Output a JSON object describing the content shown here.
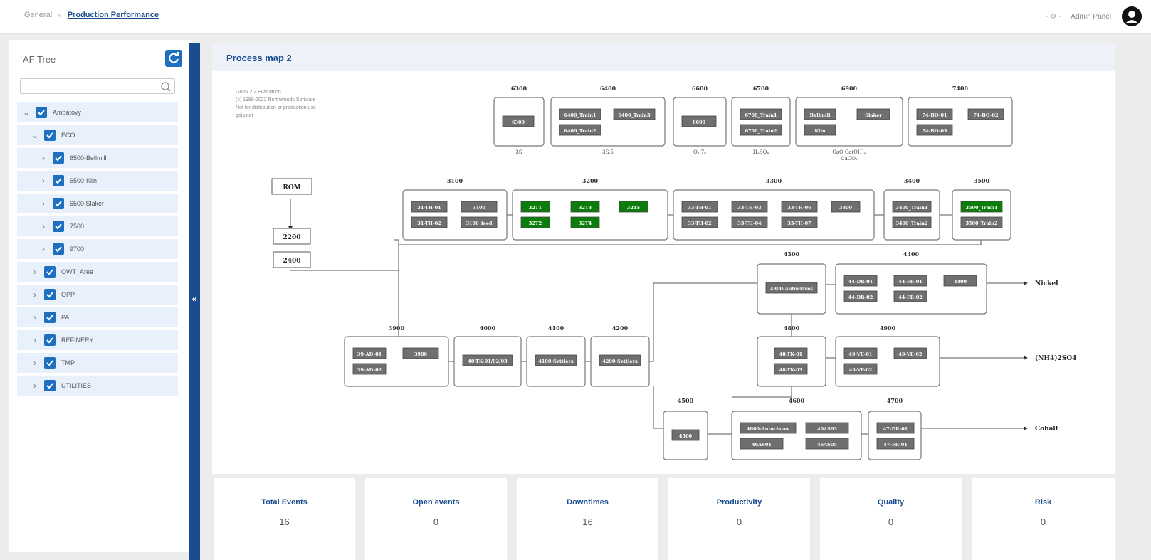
{
  "header": {
    "breadcrumb_home": "General",
    "breadcrumb_sep": "»",
    "breadcrumb_current": "Production Performance",
    "meta": "· ⚙ ·",
    "user": "Admin Panel"
  },
  "tree": {
    "title": "AF Tree",
    "search_placeholder": "",
    "items": [
      {
        "label": "Ambatovy",
        "level": 0,
        "expanded": true
      },
      {
        "label": "ECO",
        "level": 1,
        "expanded": true
      },
      {
        "label": "6500-Bellmill",
        "level": 2,
        "expanded": false
      },
      {
        "label": "6500-Kiln",
        "level": 2,
        "expanded": false
      },
      {
        "label": "6500 Slaker",
        "level": 2,
        "expanded": false
      },
      {
        "label": "7500",
        "level": 2,
        "expanded": false
      },
      {
        "label": "9700",
        "level": 2,
        "expanded": false
      },
      {
        "label": "OWT_Area",
        "level": 1,
        "expanded": false
      },
      {
        "label": "OPP",
        "level": 1,
        "expanded": false
      },
      {
        "label": "PAL",
        "level": 1,
        "expanded": false
      },
      {
        "label": "REFINERY",
        "level": 1,
        "expanded": false
      },
      {
        "label": "TMP",
        "level": 1,
        "expanded": false
      },
      {
        "label": "UTILITIES",
        "level": 1,
        "expanded": false
      }
    ]
  },
  "panel": {
    "title": "Process map 2",
    "watermark": [
      "GoJS 2.2 Evaluation",
      "(c) 1998-2022 Northwoods Software",
      "Not for distribution or production use",
      "gojs.net"
    ]
  },
  "colors": {
    "node_gray": "#6f6f6f",
    "node_green": "#0b7d0b",
    "accent": "#1a4d8f"
  },
  "map": {
    "groups": [
      {
        "id": "6300",
        "label": "6300",
        "sub": "3S",
        "nodes": [
          {
            "t": "6300",
            "s": "gray"
          }
        ]
      },
      {
        "id": "6400",
        "label": "6400",
        "sub": "3S.5",
        "nodes": [
          {
            "t": "6400_Train1",
            "s": "gray"
          },
          {
            "t": "6400_Train3",
            "s": "gray"
          },
          {
            "t": "6400_Train2",
            "s": "gray"
          }
        ]
      },
      {
        "id": "6600",
        "label": "6600",
        "sub": "O₂ 7₅",
        "nodes": [
          {
            "t": "6600",
            "s": "gray"
          }
        ]
      },
      {
        "id": "6700",
        "label": "6700",
        "sub": "H₂SO₄",
        "nodes": [
          {
            "t": "6700_Train1",
            "s": "gray"
          },
          {
            "t": "6700_Train2",
            "s": "gray"
          }
        ]
      },
      {
        "id": "6900",
        "label": "6900",
        "sub": "CaO Ca(OH)₂",
        "sub2": "CaCO₃",
        "nodes": [
          {
            "t": "Ballmill",
            "s": "gray"
          },
          {
            "t": "Slaker",
            "s": "gray"
          },
          {
            "t": "Kiln",
            "s": "gray"
          }
        ]
      },
      {
        "id": "7400",
        "label": "7400",
        "sub": "",
        "nodes": [
          {
            "t": "74-BO-01",
            "s": "gray"
          },
          {
            "t": "74-BO-02",
            "s": "gray"
          },
          {
            "t": "74-BO-03",
            "s": "gray"
          }
        ]
      },
      {
        "id": "3100",
        "label": "3100",
        "sub": "",
        "nodes": [
          {
            "t": "31-TH-01",
            "s": "gray"
          },
          {
            "t": "3100",
            "s": "gray"
          },
          {
            "t": "31-TH-02",
            "s": "gray"
          },
          {
            "t": "3100_feed",
            "s": "gray"
          }
        ]
      },
      {
        "id": "3200",
        "label": "3200",
        "sub": "",
        "nodes": [
          {
            "t": "32T1",
            "s": "green"
          },
          {
            "t": "32T3",
            "s": "green"
          },
          {
            "t": "32T5",
            "s": "green"
          },
          {
            "t": "32T2",
            "s": "green"
          },
          {
            "t": "32T4",
            "s": "green"
          }
        ]
      },
      {
        "id": "3300",
        "label": "3300",
        "sub": "",
        "nodes": [
          {
            "t": "33-TH-01",
            "s": "gray"
          },
          {
            "t": "33-TH-03",
            "s": "gray"
          },
          {
            "t": "33-TH-06",
            "s": "gray"
          },
          {
            "t": "3300",
            "s": "gray"
          },
          {
            "t": "33-TH-02",
            "s": "gray"
          },
          {
            "t": "33-TH-04",
            "s": "gray"
          },
          {
            "t": "33-TH-07",
            "s": "gray"
          }
        ]
      },
      {
        "id": "3400",
        "label": "3400",
        "sub": "",
        "nodes": [
          {
            "t": "3400_Train1",
            "s": "gray"
          },
          {
            "t": "3400_Train2",
            "s": "gray"
          }
        ]
      },
      {
        "id": "3500",
        "label": "3500",
        "sub": "",
        "nodes": [
          {
            "t": "3500_Train1",
            "s": "green"
          },
          {
            "t": "3500_Train2",
            "s": "gray"
          }
        ]
      },
      {
        "id": "4300",
        "label": "4300",
        "sub": "",
        "nodes": [
          {
            "t": "4300-Autoclaves",
            "s": "gray"
          }
        ]
      },
      {
        "id": "4400",
        "label": "4400",
        "sub": "",
        "nodes": [
          {
            "t": "44-DR-01",
            "s": "gray"
          },
          {
            "t": "44-FR-01",
            "s": "gray"
          },
          {
            "t": "4400",
            "s": "gray"
          },
          {
            "t": "44-DR-02",
            "s": "gray"
          },
          {
            "t": "44-FR-02",
            "s": "gray"
          }
        ]
      },
      {
        "id": "3900",
        "label": "3900",
        "sub": "",
        "nodes": [
          {
            "t": "39-AD-01",
            "s": "gray"
          },
          {
            "t": "3900",
            "s": "gray"
          },
          {
            "t": "39-AD-02",
            "s": "gray"
          }
        ]
      },
      {
        "id": "4000",
        "label": "4000",
        "sub": "",
        "nodes": [
          {
            "t": "40-TK-01/02/03",
            "s": "gray"
          }
        ]
      },
      {
        "id": "4100",
        "label": "4100",
        "sub": "",
        "nodes": [
          {
            "t": "4100-Settlers",
            "s": "gray"
          }
        ]
      },
      {
        "id": "4200",
        "label": "4200",
        "sub": "",
        "nodes": [
          {
            "t": "4200-Settlers",
            "s": "gray"
          }
        ]
      },
      {
        "id": "4800",
        "label": "4800",
        "sub": "",
        "nodes": [
          {
            "t": "48-TK-01",
            "s": "gray"
          },
          {
            "t": "48-TK-03",
            "s": "gray"
          }
        ]
      },
      {
        "id": "4900",
        "label": "4900",
        "sub": "",
        "nodes": [
          {
            "t": "49-VE-01",
            "s": "gray"
          },
          {
            "t": "49-VE-02",
            "s": "gray"
          },
          {
            "t": "49-VP-02",
            "s": "gray"
          }
        ]
      },
      {
        "id": "4500",
        "label": "4500",
        "sub": "",
        "nodes": [
          {
            "t": "4500",
            "s": "gray"
          }
        ]
      },
      {
        "id": "4600",
        "label": "4600",
        "sub": "",
        "nodes": [
          {
            "t": "4600-Autoclaves",
            "s": "gray"
          },
          {
            "t": "46AS03",
            "s": "gray"
          },
          {
            "t": "46AS01",
            "s": "gray"
          },
          {
            "t": "46AS05",
            "s": "gray"
          }
        ]
      },
      {
        "id": "4700",
        "label": "4700",
        "sub": "",
        "nodes": [
          {
            "t": "47-DR-01",
            "s": "gray"
          },
          {
            "t": "47-FR-01",
            "s": "gray"
          }
        ]
      }
    ],
    "plain": [
      "ROM",
      "2200",
      "2400"
    ],
    "outputs": [
      "Nickel",
      "(NH4)2SO4",
      "Cobalt"
    ]
  },
  "kpis": [
    {
      "label": "Total Events",
      "value": "16"
    },
    {
      "label": "Open events",
      "value": "0"
    },
    {
      "label": "Downtimes",
      "value": "16"
    },
    {
      "label": "Productivity",
      "value": "0"
    },
    {
      "label": "Quality",
      "value": "0"
    },
    {
      "label": "Risk",
      "value": "0"
    }
  ]
}
